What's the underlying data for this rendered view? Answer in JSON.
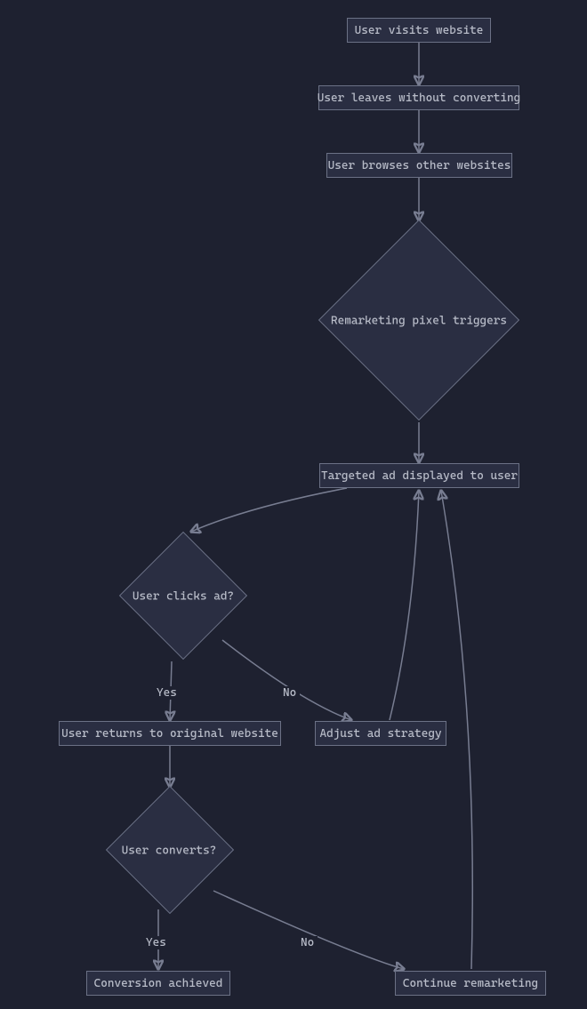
{
  "chart_data": {
    "type": "flowchart",
    "nodes": [
      {
        "id": "n1",
        "label": "User visits website",
        "shape": "rect"
      },
      {
        "id": "n2",
        "label": "User leaves without converting",
        "shape": "rect"
      },
      {
        "id": "n3",
        "label": "User browses other websites",
        "shape": "rect"
      },
      {
        "id": "n4",
        "label": "Remarketing pixel triggers",
        "shape": "diamond"
      },
      {
        "id": "n5",
        "label": "Targeted ad displayed to user",
        "shape": "rect"
      },
      {
        "id": "n6",
        "label": "User clicks ad?",
        "shape": "diamond"
      },
      {
        "id": "n7",
        "label": "User returns to original website",
        "shape": "rect"
      },
      {
        "id": "n8",
        "label": "Adjust ad strategy",
        "shape": "rect"
      },
      {
        "id": "n9",
        "label": "User converts?",
        "shape": "diamond"
      },
      {
        "id": "n10",
        "label": "Conversion achieved",
        "shape": "rect"
      },
      {
        "id": "n11",
        "label": "Continue remarketing",
        "shape": "rect"
      }
    ],
    "edges": [
      {
        "from": "n1",
        "to": "n2"
      },
      {
        "from": "n2",
        "to": "n3"
      },
      {
        "from": "n3",
        "to": "n4"
      },
      {
        "from": "n4",
        "to": "n5"
      },
      {
        "from": "n5",
        "to": "n6"
      },
      {
        "from": "n6",
        "to": "n7",
        "label": "Yes"
      },
      {
        "from": "n6",
        "to": "n8",
        "label": "No"
      },
      {
        "from": "n7",
        "to": "n9"
      },
      {
        "from": "n8",
        "to": "n5"
      },
      {
        "from": "n9",
        "to": "n10",
        "label": "Yes"
      },
      {
        "from": "n9",
        "to": "n11",
        "label": "No"
      },
      {
        "from": "n11",
        "to": "n5"
      }
    ]
  },
  "labels": {
    "yes": "Yes",
    "no": "No"
  }
}
